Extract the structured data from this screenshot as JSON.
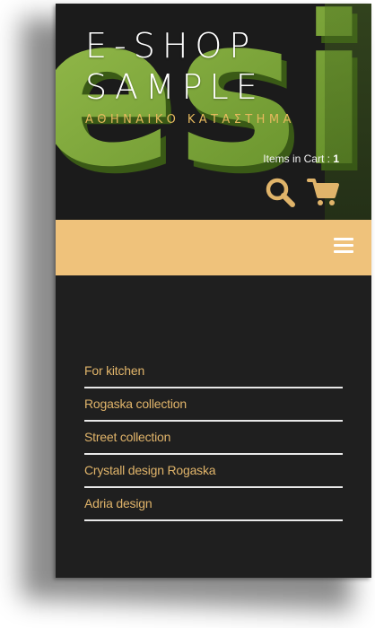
{
  "logo": {
    "line1": "E-SHOP",
    "line2": "SAMPLE",
    "tagline": "ΑΘΗΝΑΙΚΟ ΚΑΤΑΣΤΗΜΑ",
    "background_text": "esi"
  },
  "cart": {
    "label": "Items in Cart : ",
    "count": "1"
  },
  "icons": {
    "search": "search-icon",
    "cart": "cart-icon",
    "menu": "hamburger-menu-icon"
  },
  "colors": {
    "accent": "#e0b46a",
    "nav_bar": "#efc27b",
    "green": "#7aa83a",
    "background": "#1f1f1f"
  },
  "menu": {
    "items": [
      {
        "label": "For kitchen"
      },
      {
        "label": "Rogaska collection"
      },
      {
        "label": "Street collection"
      },
      {
        "label": "Crystall design Rogaska"
      },
      {
        "label": "Adria design"
      }
    ]
  }
}
